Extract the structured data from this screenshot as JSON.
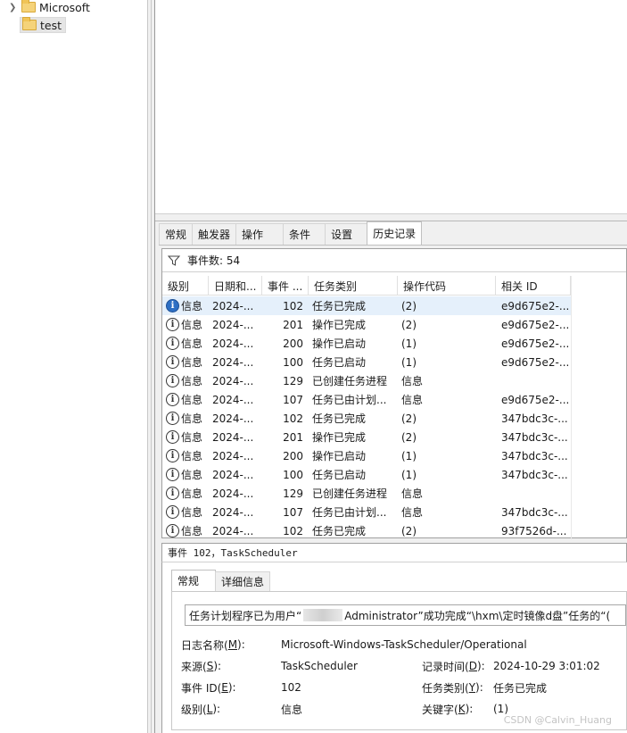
{
  "tree": {
    "items": [
      {
        "label": "Microsoft"
      },
      {
        "label": "test"
      }
    ]
  },
  "tabs": [
    "常规",
    "触发器",
    "操作",
    "条件",
    "设置",
    "历史记录"
  ],
  "history": {
    "filter_text": "事件数: 54",
    "columns": [
      "级别",
      "日期和...",
      "事件 ...",
      "任务类别",
      "操作代码",
      "相关 ID"
    ],
    "rows": [
      [
        "信息",
        "2024-...",
        "102",
        "任务已完成",
        "(2)",
        "e9d675e2-..."
      ],
      [
        "信息",
        "2024-...",
        "201",
        "操作已完成",
        "(2)",
        "e9d675e2-..."
      ],
      [
        "信息",
        "2024-...",
        "200",
        "操作已启动",
        "(1)",
        "e9d675e2-..."
      ],
      [
        "信息",
        "2024-...",
        "100",
        "任务已启动",
        "(1)",
        "e9d675e2-..."
      ],
      [
        "信息",
        "2024-...",
        "129",
        "已创建任务进程",
        "信息",
        ""
      ],
      [
        "信息",
        "2024-...",
        "107",
        "任务已由计划...",
        "信息",
        "e9d675e2-..."
      ],
      [
        "信息",
        "2024-...",
        "102",
        "任务已完成",
        "(2)",
        "347bdc3c-..."
      ],
      [
        "信息",
        "2024-...",
        "201",
        "操作已完成",
        "(2)",
        "347bdc3c-..."
      ],
      [
        "信息",
        "2024-...",
        "200",
        "操作已启动",
        "(1)",
        "347bdc3c-..."
      ],
      [
        "信息",
        "2024-...",
        "100",
        "任务已启动",
        "(1)",
        "347bdc3c-..."
      ],
      [
        "信息",
        "2024-...",
        "129",
        "已创建任务进程",
        "信息",
        ""
      ],
      [
        "信息",
        "2024-...",
        "107",
        "任务已由计划...",
        "信息",
        "347bdc3c-..."
      ],
      [
        "信息",
        "2024-...",
        "102",
        "任务已完成",
        "(2)",
        "93f7526d-..."
      ]
    ]
  },
  "detail": {
    "title": "事件 102，TaskScheduler",
    "tabs": [
      "常规",
      "详细信息"
    ],
    "desc_prefix": "任务计划程序已为用户“",
    "desc_suffix": "Administrator”成功完成“\\hxm\\定时镜像d盘”任务的“(",
    "log_name_label": "日志名称(M):",
    "log_name_value": "Microsoft-Windows-TaskScheduler/Operational",
    "source_label": "来源(S):",
    "source_value": "TaskScheduler",
    "logged_label": "记录时间(D):",
    "logged_value": "2024-10-29 3:01:02",
    "event_id_label": "事件 ID(E):",
    "event_id_value": "102",
    "task_cat_label": "任务类别(Y):",
    "task_cat_value": "任务已完成",
    "level_label": "级别(L):",
    "level_value": "信息",
    "keywords_label": "关键字(K):",
    "keywords_value": "(1)",
    "watermark": "CSDN @Calvin_Huang"
  }
}
